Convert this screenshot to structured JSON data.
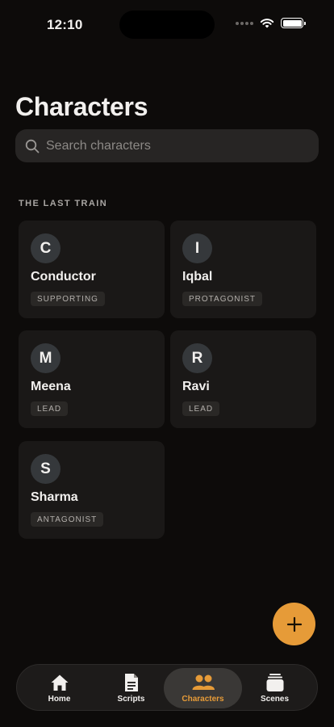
{
  "status_bar": {
    "time": "12:10"
  },
  "header": {
    "title": "Characters"
  },
  "search": {
    "placeholder": "Search characters"
  },
  "section": {
    "label": "THE LAST TRAIN"
  },
  "characters": [
    {
      "initial": "C",
      "name": "Conductor",
      "role": "SUPPORTING"
    },
    {
      "initial": "I",
      "name": "Iqbal",
      "role": "PROTAGONIST"
    },
    {
      "initial": "M",
      "name": "Meena",
      "role": "LEAD"
    },
    {
      "initial": "R",
      "name": "Ravi",
      "role": "LEAD"
    },
    {
      "initial": "S",
      "name": "Sharma",
      "role": "ANTAGONIST"
    }
  ],
  "fab": {
    "icon": "plus-icon"
  },
  "tabbar": {
    "tabs": [
      {
        "label": "Home",
        "icon": "home-icon"
      },
      {
        "label": "Scripts",
        "icon": "document-icon"
      },
      {
        "label": "Characters",
        "icon": "people-icon",
        "active": true
      },
      {
        "label": "Scenes",
        "icon": "stack-icon"
      }
    ]
  },
  "colors": {
    "accent": "#e69b38",
    "background": "#0d0b0a",
    "card": "#1a1817"
  }
}
